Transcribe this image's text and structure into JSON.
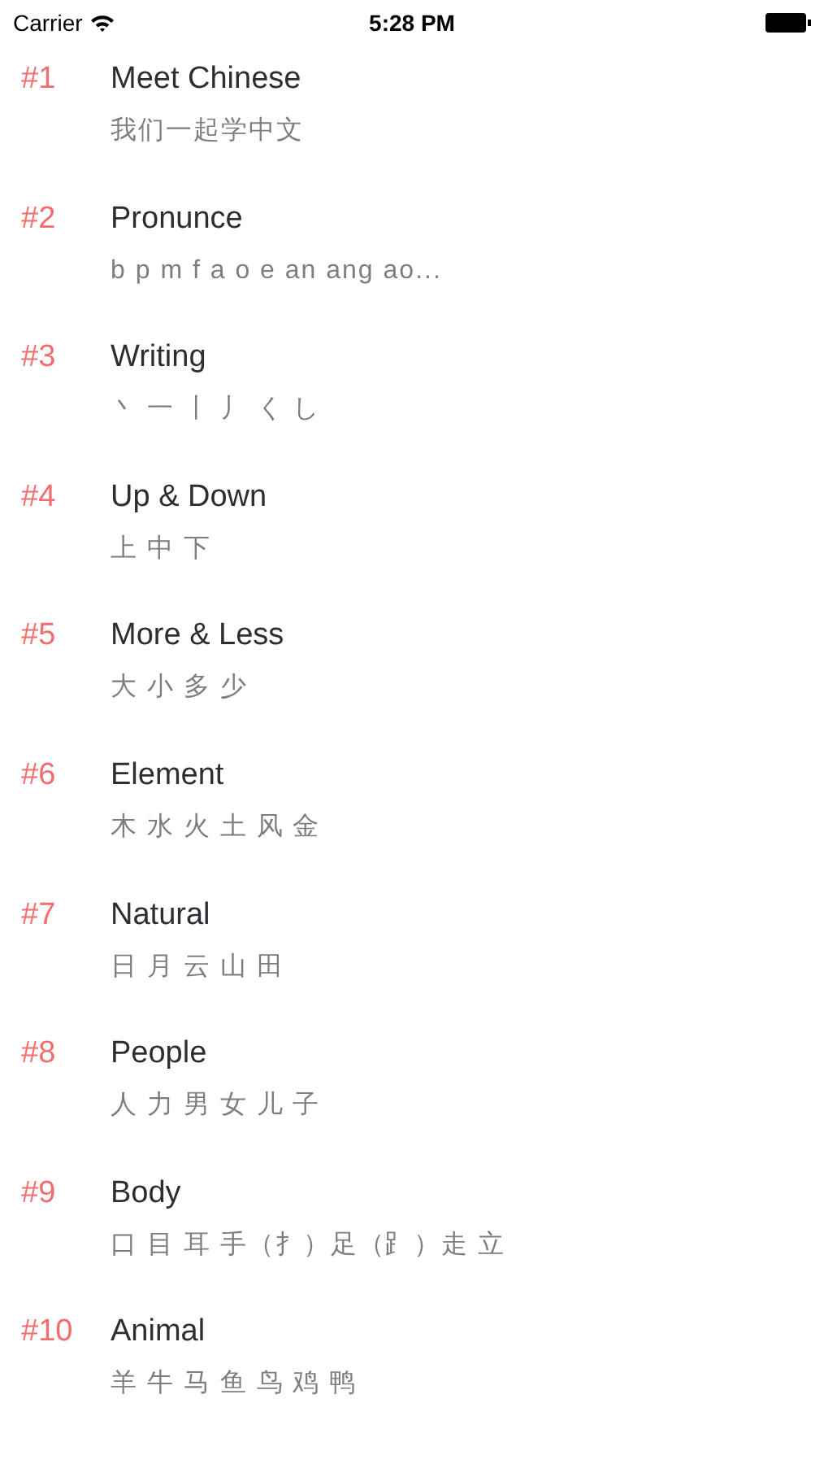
{
  "status_bar": {
    "carrier": "Carrier",
    "time": "5:28 PM"
  },
  "lessons": [
    {
      "number": "#1",
      "title": "Meet Chinese",
      "subtitle": "我们一起学中文"
    },
    {
      "number": "#2",
      "title": "Pronunce",
      "subtitle": "b p m f a o e an ang ao..."
    },
    {
      "number": "#3",
      "title": "Writing",
      "subtitle": "丶 一 丨 丿 く し"
    },
    {
      "number": "#4",
      "title": "Up & Down",
      "subtitle": "上 中 下"
    },
    {
      "number": "#5",
      "title": "More & Less",
      "subtitle": "大 小 多 少"
    },
    {
      "number": "#6",
      "title": "Element",
      "subtitle": "木 水 火 土 风 金"
    },
    {
      "number": "#7",
      "title": "Natural",
      "subtitle": "日 月 云 山 田"
    },
    {
      "number": "#8",
      "title": "People",
      "subtitle": "人 力 男 女 儿 子"
    },
    {
      "number": "#9",
      "title": "Body",
      "subtitle": "口 目 耳 手（扌）足（⻊）走 立"
    },
    {
      "number": "#10",
      "title": "Animal",
      "subtitle": "羊 牛 马 鱼 鸟 鸡 鸭"
    }
  ]
}
